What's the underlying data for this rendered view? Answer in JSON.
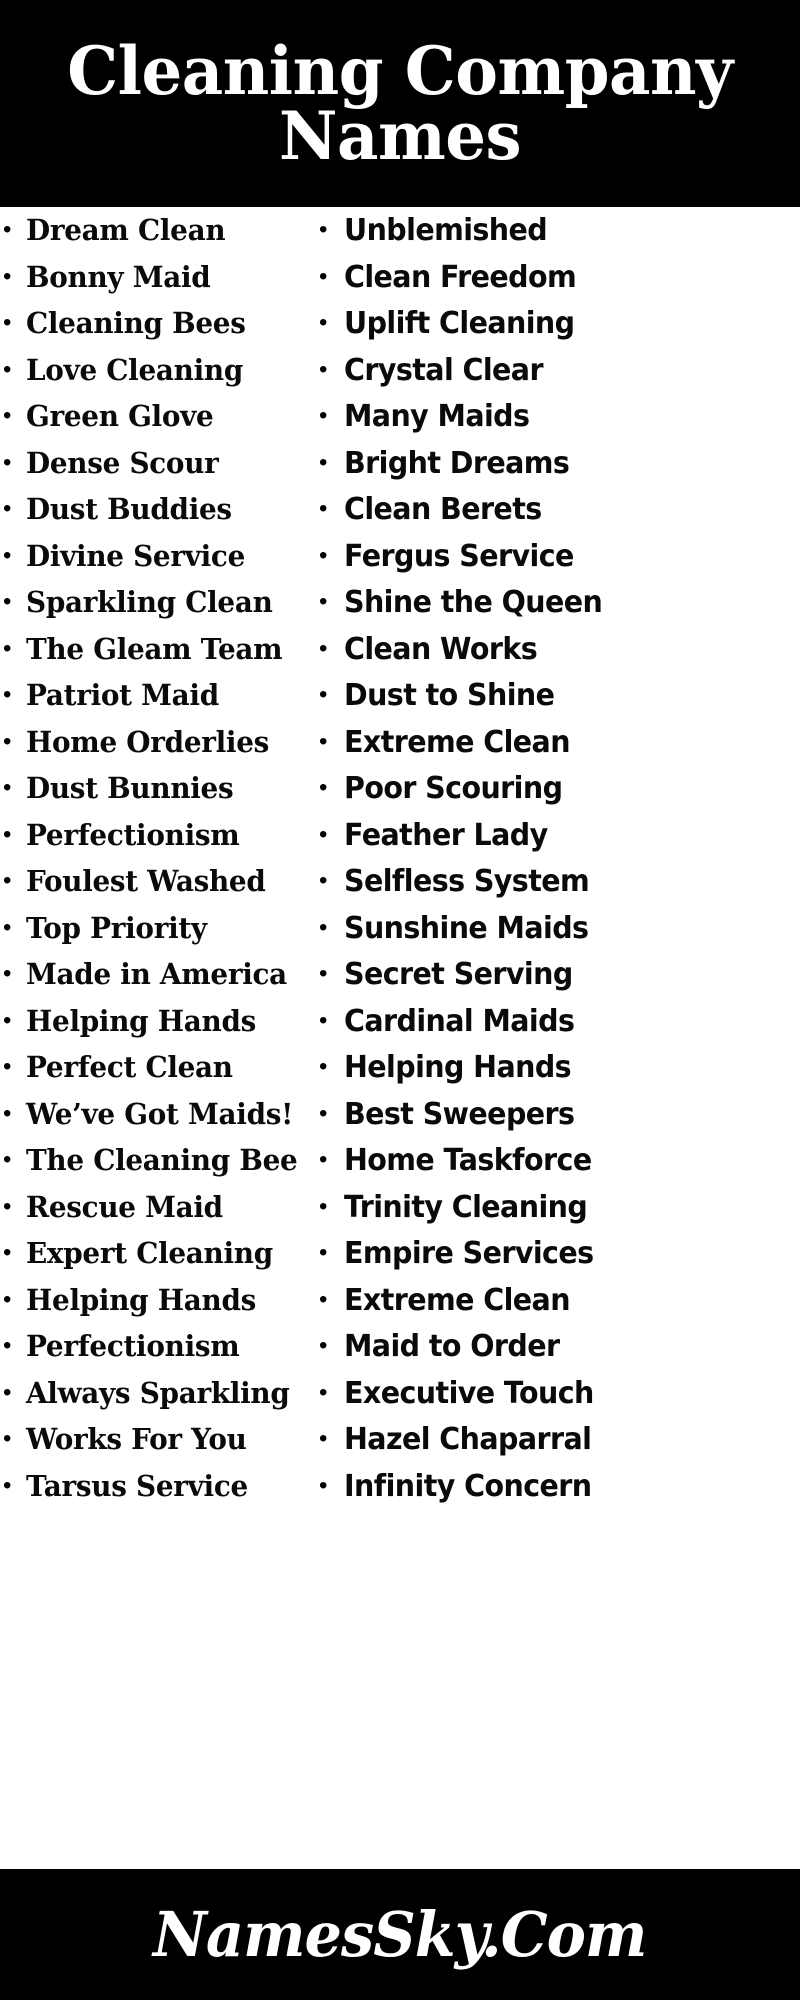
{
  "header": {
    "title": "Cleaning Company Names",
    "background_color": "#000000",
    "text_color": "#ffffff"
  },
  "footer": {
    "brand": "NamesSky.Com",
    "background_color": "#000000",
    "text_color": "#ffffff"
  },
  "bullet_glyph": "•",
  "columns": [
    {
      "id": "left",
      "items": [
        "Dream Clean",
        "Bonny Maid",
        "Cleaning Bees",
        "Love Cleaning",
        "Green Glove",
        "Dense Scour",
        "Dust Buddies",
        "Divine Service",
        "Sparkling Clean",
        "The Gleam Team",
        "Patriot Maid",
        "Home Orderlies",
        "Dust Bunnies",
        "Perfectionism",
        "Foulest Washed",
        "Top Priority",
        "Made in America",
        "Helping Hands",
        "Perfect Clean",
        "We’ve Got Maids!",
        "The Cleaning Bee",
        "Rescue Maid",
        "Expert Cleaning",
        "Helping Hands",
        "Perfectionism",
        "Always Sparkling",
        "Works For You",
        "Tarsus Service"
      ]
    },
    {
      "id": "right",
      "items": [
        "Unblemished",
        "Clean Freedom",
        "Uplift Cleaning",
        "Crystal Clear",
        "Many Maids",
        "Bright Dreams",
        "Clean Berets",
        "Fergus Service",
        "Shine the Queen",
        "Clean Works",
        "Dust to Shine",
        "Extreme Clean",
        "Poor Scouring",
        "Feather Lady",
        "Selfless System",
        "Sunshine Maids",
        "Secret Serving",
        "Cardinal Maids",
        "Helping Hands",
        "Best Sweepers",
        "Home Taskforce",
        "Trinity Cleaning",
        "Empire Services",
        "Extreme Clean",
        "Maid to Order",
        "Executive Touch",
        "Hazel Chaparral",
        "Infinity Concern"
      ]
    }
  ]
}
